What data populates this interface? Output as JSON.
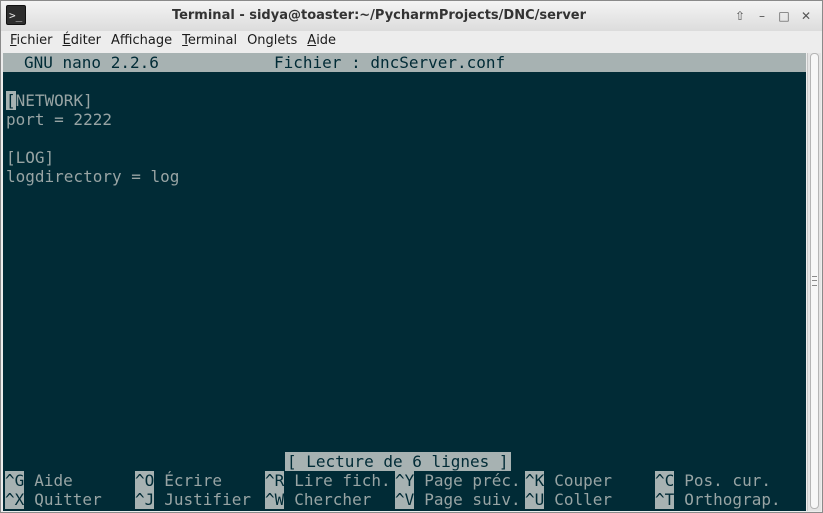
{
  "window": {
    "title": "Terminal - sidya@toaster:~/PycharmProjects/DNC/server",
    "app_icon_glyph": ">_",
    "controls": {
      "up": "⇧",
      "minimize": "–",
      "maximize": "□",
      "close": "✕"
    }
  },
  "menubar": {
    "items": [
      {
        "mnemonic": "F",
        "rest": "ichier"
      },
      {
        "mnemonic": "É",
        "rest": "diter"
      },
      {
        "mnemonic": "",
        "rest": "Affichage"
      },
      {
        "mnemonic": "T",
        "rest": "erminal"
      },
      {
        "mnemonic": "",
        "rest": "Onglets"
      },
      {
        "mnemonic": "A",
        "rest": "ide"
      }
    ]
  },
  "nano": {
    "version": "GNU nano 2.2.6",
    "file_label": "Fichier : dncServer.conf",
    "lines": {
      "l1_cursor": "[",
      "l1_rest": "NETWORK]",
      "l2": "port = 2222",
      "l3": "",
      "l4": "[LOG]",
      "l5": "logdirectory = log"
    },
    "status": "[ Lecture de 6 lignes ]",
    "shortcuts": [
      {
        "key": "^G",
        "label": "Aide"
      },
      {
        "key": "^X",
        "label": "Quitter"
      },
      {
        "key": "^O",
        "label": "Écrire"
      },
      {
        "key": "^J",
        "label": "Justifier"
      },
      {
        "key": "^R",
        "label": "Lire fich."
      },
      {
        "key": "^W",
        "label": "Chercher"
      },
      {
        "key": "^Y",
        "label": "Page préc."
      },
      {
        "key": "^V",
        "label": "Page suiv."
      },
      {
        "key": "^K",
        "label": "Couper"
      },
      {
        "key": "^U",
        "label": "Coller"
      },
      {
        "key": "^C",
        "label": "Pos. cur."
      },
      {
        "key": "^T",
        "label": "Orthograp."
      }
    ]
  },
  "colors": {
    "terminal_bg": "#012b36",
    "terminal_fg": "#98a4a4",
    "highlight_bg": "#a7b2b2"
  }
}
